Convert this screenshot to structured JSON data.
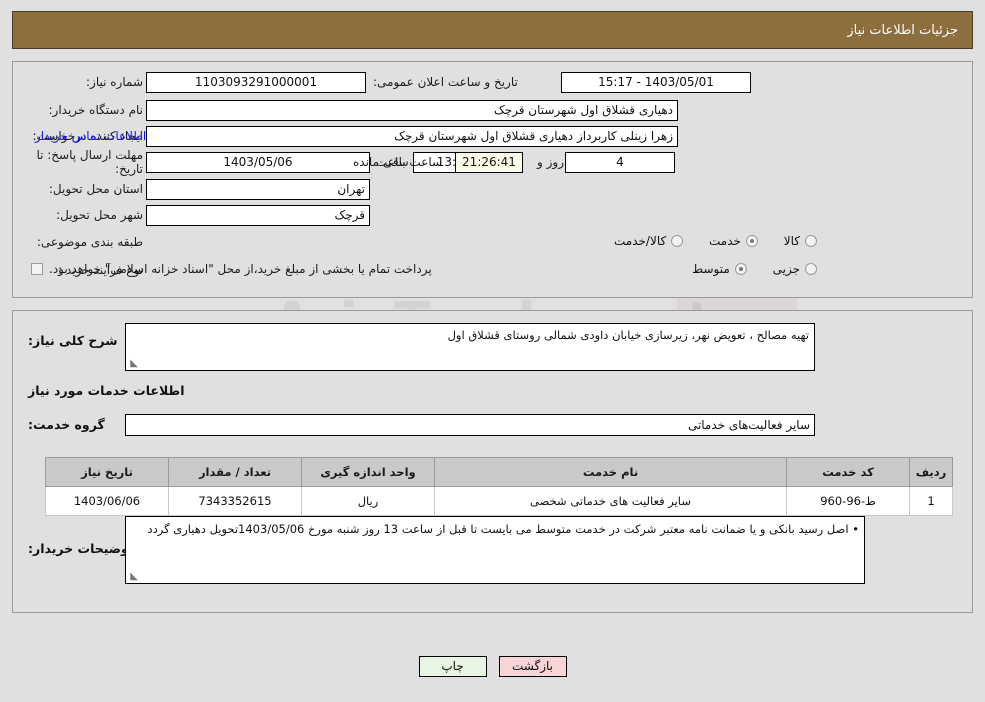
{
  "header": {
    "title": "جزئیات اطلاعات نیاز"
  },
  "watermark": {
    "text": "AriaTender.net"
  },
  "form": {
    "need_number_label": "شماره نیاز:",
    "need_number_value": "1103093291000001",
    "announce_label": "تاریخ و ساعت اعلان عمومی:",
    "announce_value": "1403/05/01 - 15:17",
    "buyer_org_label": "نام دستگاه خریدار:",
    "buyer_org_value": "دهیاری قشلاق اول شهرستان قرچک",
    "requester_label": "ایجاد کننده درخواست:",
    "requester_value": "زهرا زینلی کاربرداز دهیاری قشلاق اول شهرستان قرچک",
    "contact_link": "اطلاعات تماس خریدار",
    "deadline_label": "مهلت ارسال پاسخ: تا تاریخ:",
    "deadline_date": "1403/05/06",
    "hour_label": "ساعت",
    "deadline_time": "13:00",
    "days_remaining": "4",
    "days_label": "روز و",
    "countdown": "21:26:41",
    "remaining_label": "ساعت باقی مانده",
    "province_label": "استان محل تحویل:",
    "province_value": "تهران",
    "city_label": "شهر محل تحویل:",
    "city_value": "قرچک",
    "category_label": "طبقه بندی موضوعی:",
    "category_options": [
      {
        "label": "کالا",
        "selected": false
      },
      {
        "label": "خدمت",
        "selected": true
      },
      {
        "label": "کالا/خدمت",
        "selected": false
      }
    ],
    "process_label": "نوع فرآیند خرید :",
    "process_options": [
      {
        "label": "جزیی",
        "selected": false
      },
      {
        "label": "متوسط",
        "selected": true
      }
    ],
    "treasury_checkbox_label": "پرداخت تمام یا بخشی از مبلغ خرید،از محل \"اسناد خزانه اسلامی\" خواهد بود.",
    "treasury_checked": false
  },
  "details": {
    "summary_label": "شرح کلی نیاز:",
    "summary_value": "تهیه مصالح ، تعویض نهر، زیرسازی خیابان داودی شمالی روستای قشلاق اول",
    "services_title": "اطلاعات خدمات مورد نیاز",
    "service_group_label": "گروه خدمت:",
    "service_group_value": "سایر فعالیت‌های خدماتی",
    "buyer_notes_label": "توضیحات خریدار:",
    "buyer_notes_value": "• اصل رسید بانکی و یا ضمانت نامه معتبر شرکت در خدمت متوسط می بایست تا قبل از ساعت 13 روز  شنبه مورخ 1403/05/06تحویل دهیاری گردد"
  },
  "table": {
    "columns": [
      "ردیف",
      "کد خدمت",
      "نام خدمت",
      "واحد اندازه گیری",
      "تعداد / مقدار",
      "تاریخ نیاز"
    ],
    "rows": [
      {
        "row": "1",
        "code": "ط-96-960",
        "name": "سایر فعالیت های خدماتی شخصی",
        "unit": "ریال",
        "quantity": "7343352615",
        "date": "1403/06/06"
      }
    ]
  },
  "buttons": {
    "back": "بازگشت",
    "print": "چاپ"
  },
  "colors": {
    "header_bar": "#8d6e3f",
    "page_bg": "#e0e0e0",
    "link": "#1414ff",
    "back_btn": "#f9d4d4",
    "print_btn": "#e6f6e2",
    "countdown_bg": "#fbfbe8",
    "table_header": "#c9c9c9"
  }
}
